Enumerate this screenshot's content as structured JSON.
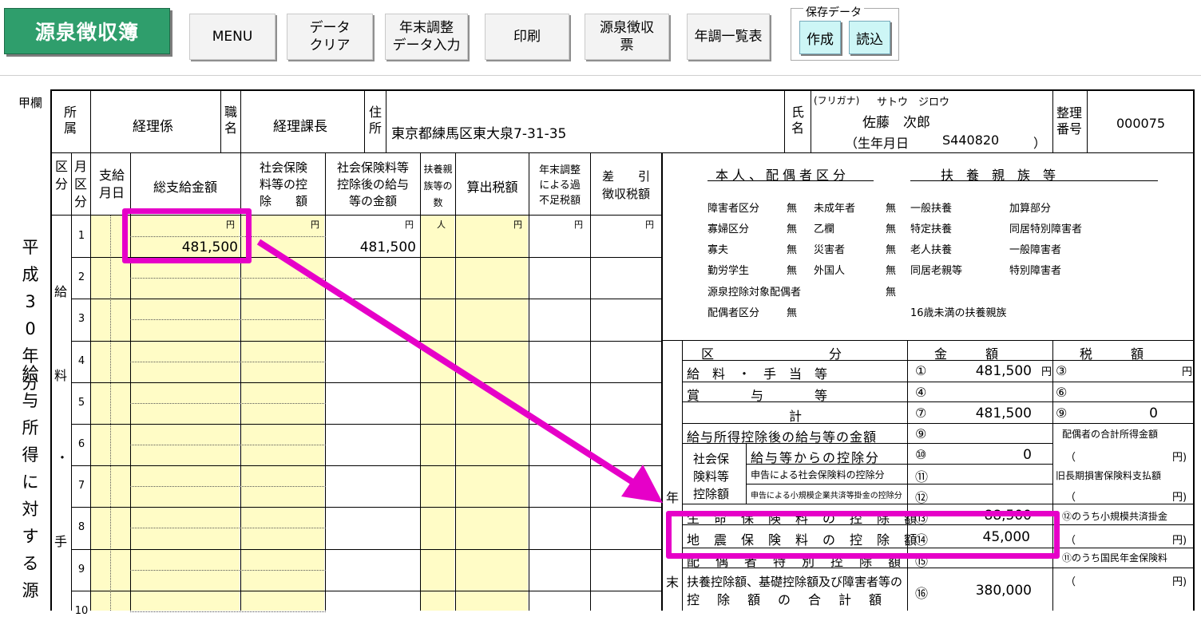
{
  "toolbar": {
    "title": "源泉徴収簿",
    "buttons": {
      "menu": "MENU",
      "data_clear": "データ\nクリア",
      "year_end_input": "年末調整\nデータ入力",
      "print": "印刷",
      "withholding_slip": "源泉徴収\n票",
      "year_end_list": "年調一覧表"
    },
    "save_data": {
      "legend": "保存データ",
      "create": "作成",
      "load": "読込"
    }
  },
  "colors": {
    "title_bg": "#2f9e6c",
    "highlight": "#e600c8",
    "input_bg": "#fffcc6",
    "save_btn_bg": "#cdf6f6"
  },
  "header": {
    "kou_ran": "甲欄",
    "affiliation_label": "所\n属",
    "affiliation_value": "経理係",
    "position_label": "職\n名",
    "position_value": "経理課長",
    "address_label": "住\n所",
    "address_value": "東京都練馬区東大泉7-31-35",
    "name_label": "氏\n名",
    "furigana_label": "(フリガナ)",
    "furigana_value": "サトウ　ジロウ",
    "name_value": "佐藤　次郎",
    "birth_label": "（生年月日",
    "birth_value": "S440820",
    "birth_close": "）",
    "ref_label": "整理\n番号",
    "ref_value": "000075"
  },
  "side_title": {
    "era": "平成30年分",
    "form": "給与所得に対する源"
  },
  "grid": {
    "col_headers": {
      "kubun": "区\n分",
      "month": "月\n区\n分",
      "pay_date": "支給\n月日",
      "total_pay": "総支給金額",
      "social_ins": "社会保険\n料等の控\n除　　額",
      "after_social": "社会保険料等\n控除後の給与\n等の金額",
      "dependents": "扶養親\n族等の\n数",
      "calc_tax": "算出税額",
      "year_end_short": "年末調整\nによる過\n不足税額",
      "net_tax": "差　　引\n徴収税額"
    },
    "units": {
      "yen": "円",
      "person": "人"
    },
    "kubun_chars": [
      "給",
      "料",
      "・",
      "手"
    ],
    "rows": [
      {
        "month": "1",
        "total_pay": "481,500",
        "after_social": "481,500"
      },
      {
        "month": "2"
      },
      {
        "month": "3"
      },
      {
        "month": "4"
      },
      {
        "month": "5"
      },
      {
        "month": "6"
      },
      {
        "month": "7"
      },
      {
        "month": "8"
      },
      {
        "month": "9"
      },
      {
        "month": "10"
      }
    ]
  },
  "classification": {
    "title_left": "本人、配偶者区分",
    "title_right": "扶　養　親　族　等",
    "items": [
      {
        "label": "障害者区分",
        "value": "無",
        "label2": "未成年者",
        "value2": "無",
        "label3": "一般扶養",
        "label4": "加算部分"
      },
      {
        "label": "寡婦区分",
        "value": "無",
        "label2": "乙欄",
        "value2": "無",
        "label3": "特定扶養",
        "label4": "同居特別障害者"
      },
      {
        "label": "寡夫",
        "value": "無",
        "label2": "災害者",
        "value2": "無",
        "label3": "老人扶養",
        "label4": "一般障害者"
      },
      {
        "label": "勤労学生",
        "value": "無",
        "label2": "外国人",
        "value2": "無",
        "label3": "同居老親等",
        "label4": "特別障害者"
      }
    ],
    "spouse_target": "源泉控除対象配偶者",
    "spouse_target_value": "無",
    "spouse_kubun": "配偶者区分",
    "spouse_kubun_value": "無",
    "under16": "16歳未満の扶養親族"
  },
  "year_end": {
    "side_chars": [
      "年",
      "末"
    ],
    "headers": {
      "kubun": "区　　　　　　　　　分",
      "amount": "金　　　額",
      "tax": "税　　　額"
    },
    "rows": {
      "salary": {
        "label": "給　料　・　手　当　等",
        "no": "①",
        "amount": "481,500",
        "tax_no": "③"
      },
      "bonus": {
        "label": "賞　　　　与　　　　等",
        "no": "④",
        "tax_no": "⑥"
      },
      "total": {
        "label": "計",
        "no": "⑦",
        "amount": "481,500",
        "tax_no": "⑨",
        "tax": "0"
      },
      "after_deduction": {
        "label": "給与所得控除後の給与等の金額",
        "no": "⑨",
        "right": "配偶者の合計所得金額"
      },
      "social_ins_group": "社会保\n険料等\n控除額",
      "from_salary": {
        "label": "給与等からの控除分",
        "no": "⑩",
        "amount": "0"
      },
      "declared_social": {
        "label": "申告による社会保険料の控除分",
        "no": "⑪",
        "right": "旧長期損害保険料支払額"
      },
      "small_biz": {
        "label": "申告による小規模企業共済等掛金の控除分",
        "no": "⑫",
        "right": "⑫のうち小規模共済掛金"
      },
      "life_ins": {
        "label": "生　命　保　険　料　の　控　除　額",
        "no": "⑬",
        "amount": "88,500"
      },
      "earthquake": {
        "label": "地　震　保　険　料　の　控　除　額",
        "no": "⑭",
        "amount": "45,000",
        "right": "⑪のうち国民年金保険料"
      },
      "spouse_special": {
        "label": "配　偶　者　特　別　控　除　額",
        "no": "⑮"
      },
      "dependent_total_1": "扶養控除額、基礎控除額及び障害者等の",
      "dependent_total_2": "控　除　額　の　合　計　額",
      "dependent_total_no": "⑯",
      "dependent_total_amount": "380,000",
      "paren_open": "（",
      "paren_close": "円)"
    }
  }
}
